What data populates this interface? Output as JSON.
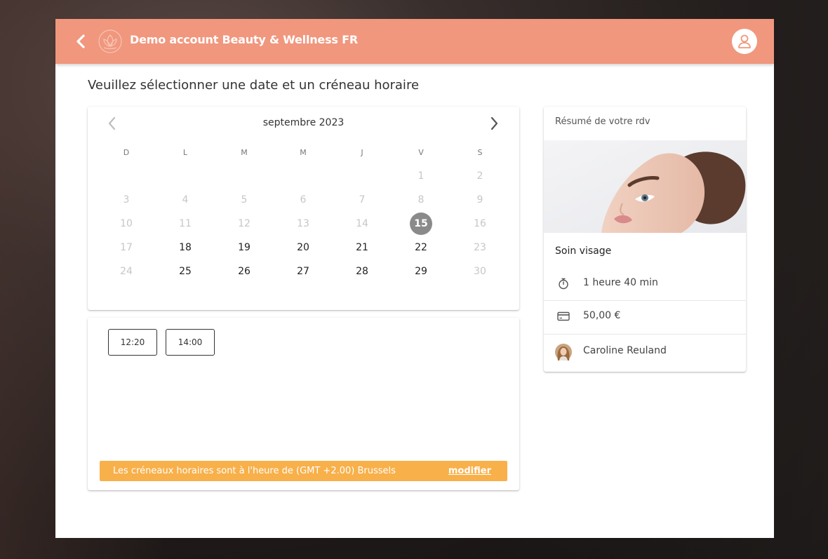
{
  "header": {
    "title": "Demo account Beauty & Wellness FR",
    "back_icon": "chevron-left-icon",
    "logo_icon": "lotus-logo-icon",
    "user_icon": "user-icon",
    "bar_color": "#f0977e"
  },
  "page": {
    "heading": "Veuillez sélectionner une date et un créneau horaire"
  },
  "calendar": {
    "month_label": "septembre 2023",
    "prev_icon": "chevron-left-icon",
    "next_icon": "chevron-right-icon",
    "weekdays": [
      "D",
      "L",
      "M",
      "M",
      "J",
      "V",
      "S"
    ],
    "weeks": [
      [
        "",
        "",
        "",
        "",
        "",
        "1",
        "2"
      ],
      [
        "3",
        "4",
        "5",
        "6",
        "7",
        "8",
        "9"
      ],
      [
        "10",
        "11",
        "12",
        "13",
        "14",
        "15",
        "16"
      ],
      [
        "17",
        "18",
        "19",
        "20",
        "21",
        "22",
        "23"
      ],
      [
        "24",
        "25",
        "26",
        "27",
        "28",
        "29",
        "30"
      ]
    ],
    "available_days": [
      "15",
      "18",
      "19",
      "20",
      "21",
      "22",
      "25",
      "26",
      "27",
      "28",
      "29"
    ],
    "selected_day": "15",
    "selected_color": "#8a8a8a"
  },
  "timeslots": {
    "slots": [
      "12:20",
      "14:00"
    ],
    "timezone_text": "Les créneaux horaires sont à l'heure de (GMT +2.00) Brussels",
    "modify_label": "modifier",
    "banner_color": "#f8b04a"
  },
  "summary": {
    "title": "Résumé de votre rdv",
    "image": "woman-face-in-milk-bath-photo",
    "service_name": "Soin visage",
    "duration": "1 heure 40 min",
    "duration_icon": "stopwatch-icon",
    "price": "50,00 €",
    "price_icon": "credit-card-icon",
    "staff": "Caroline Reuland",
    "staff_icon": "avatar"
  }
}
